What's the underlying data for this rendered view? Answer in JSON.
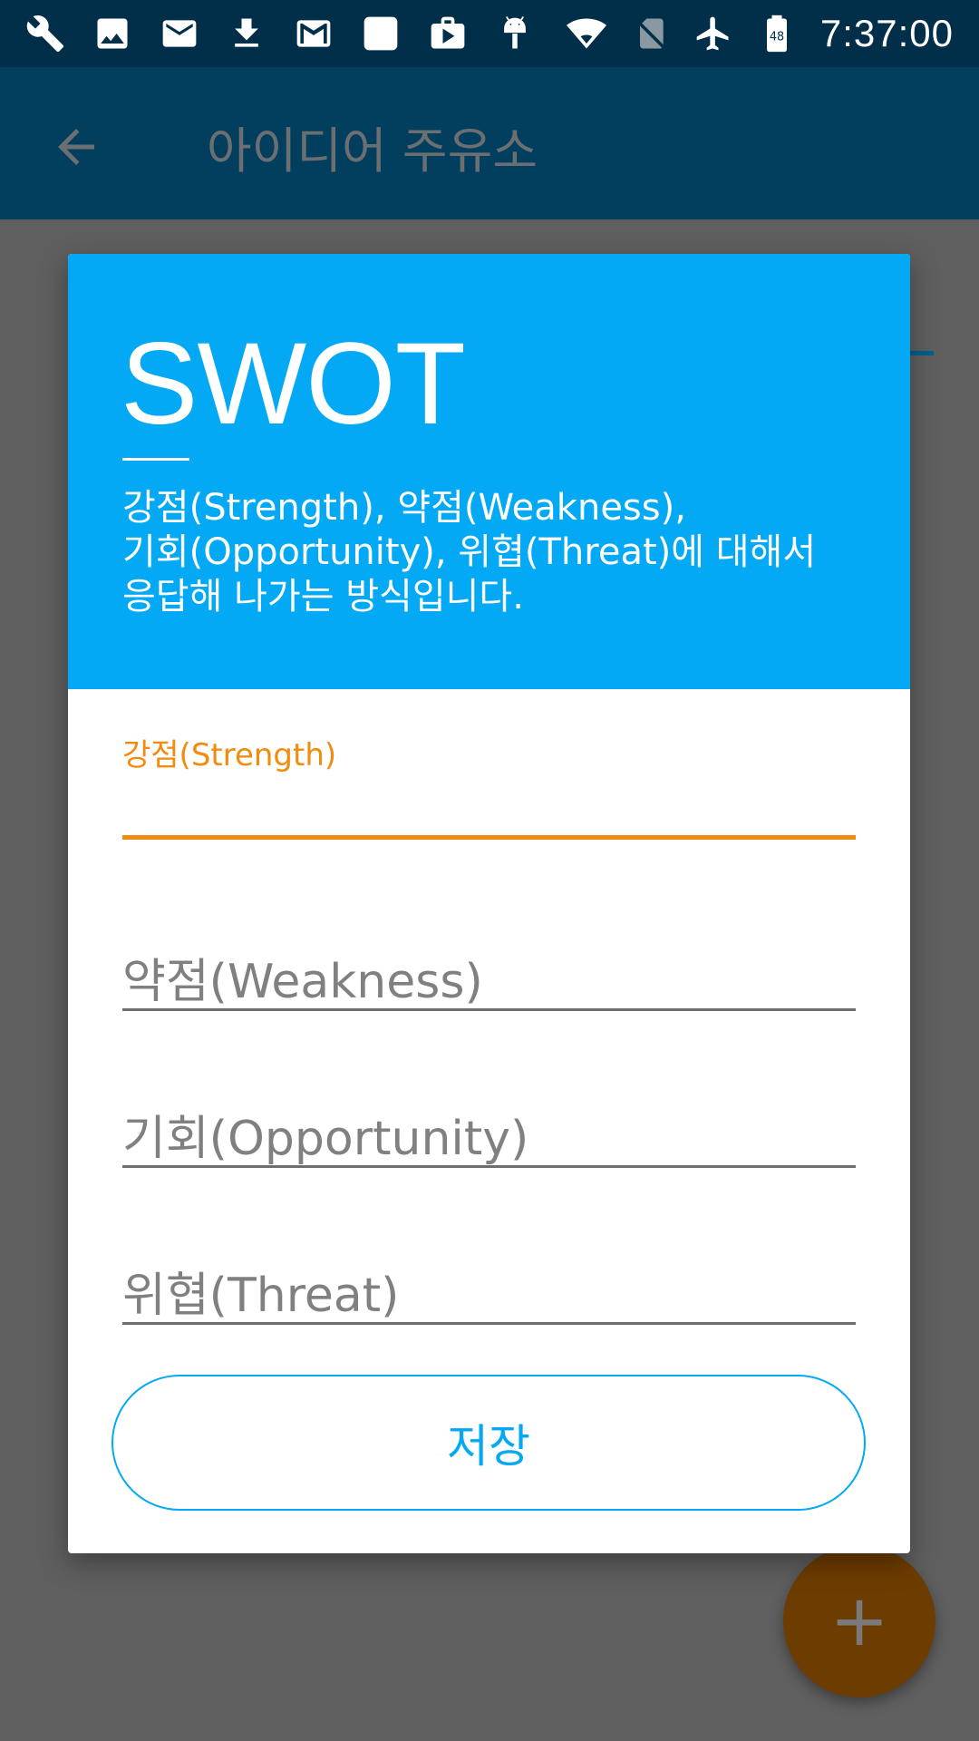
{
  "status_bar": {
    "time": "7:37:00",
    "battery_level": "48",
    "left_icons": [
      "wrench-icon",
      "image-icon",
      "mail-icon",
      "download-icon",
      "gmail-icon",
      "blank-app-icon",
      "briefcase-play-icon",
      "android-debug-icon"
    ],
    "right_icons": [
      "wifi-icon",
      "no-sim-icon",
      "airplane-icon",
      "battery-icon"
    ]
  },
  "app_bar": {
    "title": "아이디어 주유소"
  },
  "dialog": {
    "title": "SWOT",
    "description": "강점(Strength), 약점(Weakness),\n기회(Opportunity), 위협(Threat)에 대해서\n응답해 나가는 방식입니다.",
    "fields": {
      "strength": {
        "label": "강점(Strength)",
        "value": ""
      },
      "weakness": {
        "placeholder": "약점(Weakness)",
        "value": ""
      },
      "opportunity": {
        "placeholder": "기회(Opportunity)",
        "value": ""
      },
      "threat": {
        "placeholder": "위협(Threat)",
        "value": ""
      }
    },
    "save_label": "저장"
  },
  "fab": {
    "label": "+"
  },
  "colors": {
    "status_bar": "#012f4a",
    "app_bar_dimmed": "#023f5f",
    "dialog_header": "#03a9f4",
    "accent_orange": "#f28c0f",
    "scrim": "#5f5f5f"
  }
}
